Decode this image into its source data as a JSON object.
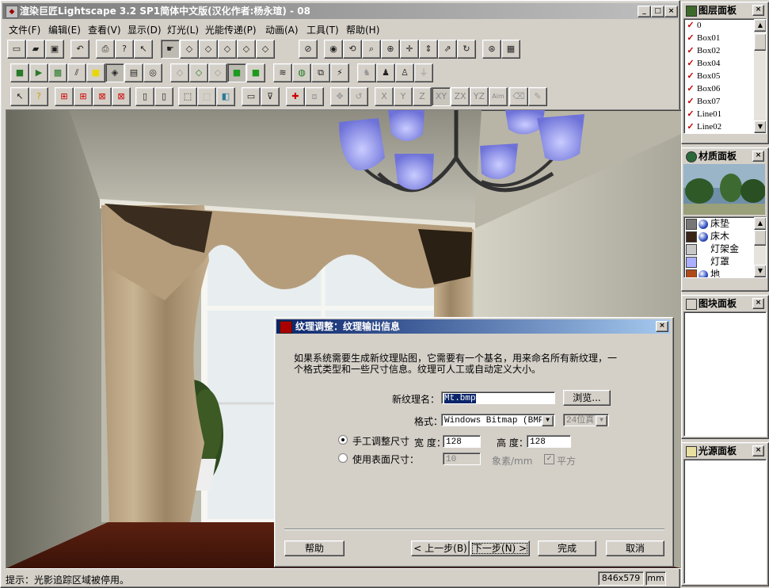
{
  "window": {
    "title": "渲染巨匠Lightscape 3.2 SP1简体中文版(汉化作者:杨永瑄) - 08",
    "minimize_glyph": "_",
    "restore_glyph": "□",
    "close_glyph": "×"
  },
  "menubar": [
    "文件(F)",
    "编辑(E)",
    "查看(V)",
    "显示(D)",
    "灯光(L)",
    "光能传递(P)",
    "动画(A)",
    "工具(T)",
    "帮助(H)"
  ],
  "toolbar_axes": [
    "X",
    "Y",
    "Z",
    "XY",
    "ZX",
    "YZ",
    "Aim"
  ],
  "status": {
    "message": "提示：光影追踪区域被停用。",
    "size": "846x579",
    "unit": "mm"
  },
  "panels": {
    "layers": {
      "title": "图层面板",
      "items": [
        "0",
        "Box01",
        "Box02",
        "Box04",
        "Box05",
        "Box06",
        "Box07",
        "Line01",
        "Line02"
      ]
    },
    "materials": {
      "title": "材质面板",
      "items": [
        {
          "label": "床垫",
          "color": "#777777",
          "sphere": true
        },
        {
          "label": "床木",
          "color": "#3a2418",
          "sphere": true
        },
        {
          "label": "灯架金",
          "color": "#c8c8c8",
          "sphere": false
        },
        {
          "label": "灯罩",
          "color": "#aab0ff",
          "sphere": false
        },
        {
          "label": "地",
          "color": "#b04a18",
          "sphere": true
        }
      ]
    },
    "blocks": {
      "title": "图块面板"
    },
    "lights": {
      "title": "光源面板"
    }
  },
  "dialog": {
    "title": "纹理调整：纹理输出信息",
    "description_line1": "如果系统需要生成新纹理贴图，它需要有一个基名，用来命名所有新纹理，一",
    "description_line2": "个格式类型和一些尺寸信息。纹理可人工或自动定义大小。",
    "name_label": "新纹理名：",
    "name_value": "Mt.bmp",
    "browse_label": "浏览...",
    "format_label": "格式：",
    "format_value": "Windows Bitmap (BMP)",
    "depth_value": "24位真",
    "manual_label": "手工调整尺寸",
    "width_label": "宽 度：",
    "width_value": "128",
    "height_label": "高 度：",
    "height_value": "128",
    "surface_label": "使用表面尺寸：",
    "surface_value": "10",
    "pixel_unit": "象素/mm",
    "square_label": "平方",
    "buttons": {
      "help": "帮助",
      "back": "< 上一步(B)",
      "next": "下一步(N) >",
      "finish": "完成",
      "cancel": "取消"
    }
  }
}
